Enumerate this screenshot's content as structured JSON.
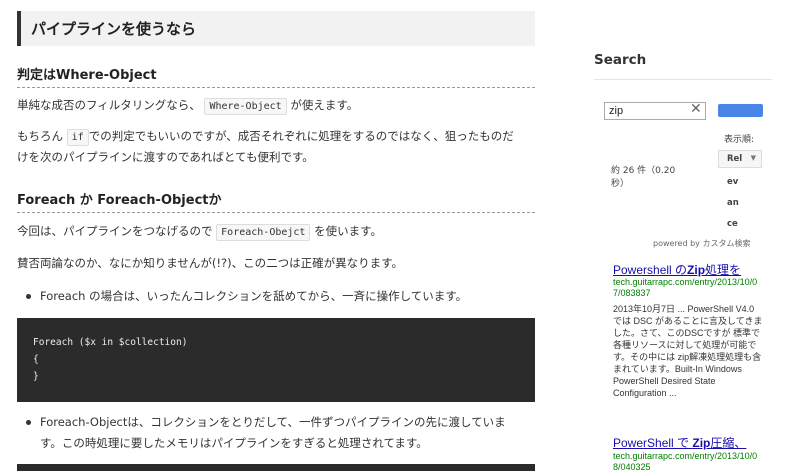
{
  "article": {
    "heading": "パイプラインを使うなら",
    "section1": {
      "heading": "判定はWhere-Object",
      "p1_before": "単純な成否のフィルタリングなら、",
      "p1_code": "Where-Object",
      "p1_after": "が使えます。",
      "p2_before": "もちろん",
      "p2_code": "if",
      "p2_after_line1": "での判定でもいいのですが、成否それぞれに処理をするのではなく、狙ったものだ",
      "p2_line2": "けを次のパイプラインに渡すのであればとても便利です。"
    },
    "section2": {
      "heading": "Foreach か Foreach-Objectか",
      "p1_before": "今回は、パイプラインをつなげるので",
      "p1_code": "Foreach-Obejct",
      "p1_after": "を使います。",
      "p2": "賛否両論なのか、なにか知りませんが(!?)、この二つは正確が異なります。",
      "bullet1": "Foreach の場合は、いったんコレクションを舐めてから、一斉に操作しています。",
      "code_lines": [
        "Foreach ($x in $collection)",
        "{",
        "}"
      ],
      "bullet2_line1": "Foreach-Objectは、コレクションをとりだして、一件ずつパイプラインの先に渡していま",
      "bullet2_line2": "す。この時処理に要したメモリはパイプラインをすぎると処理されてます。"
    }
  },
  "sidebar": {
    "title": "Search",
    "search": {
      "value": "zip",
      "clear_icon": "close-icon"
    },
    "sort_label": "表示順:",
    "sort_value": "Rel",
    "sort_overflow": [
      "ev",
      "an",
      "ce"
    ],
    "result_count": "約 26 件（0.20 秒）",
    "powered_by": "powered by カスタム検索",
    "results": [
      {
        "title_pre": "Powershell の",
        "title_bold": "Zip",
        "title_post": "処理を",
        "url": "tech.guitarrapc.com/entry/2013/10/07/083837",
        "snippet": "2013年10月7日 ... PowerShell V4.0 では DSC があることに言及してきました。さて、このDSCですが 標準で各種リソースに対して処理が可能です。その中には zip解凍処理処理も含まれています。Built-In Windows PowerShell Desired State Configuration ..."
      },
      {
        "title_pre": "PowerShell で ",
        "title_bold": "Zip",
        "title_post": "圧縮、",
        "url": "tech.guitarrapc.com/entry/2013/10/08/040325",
        "snippet": ""
      }
    ]
  }
}
